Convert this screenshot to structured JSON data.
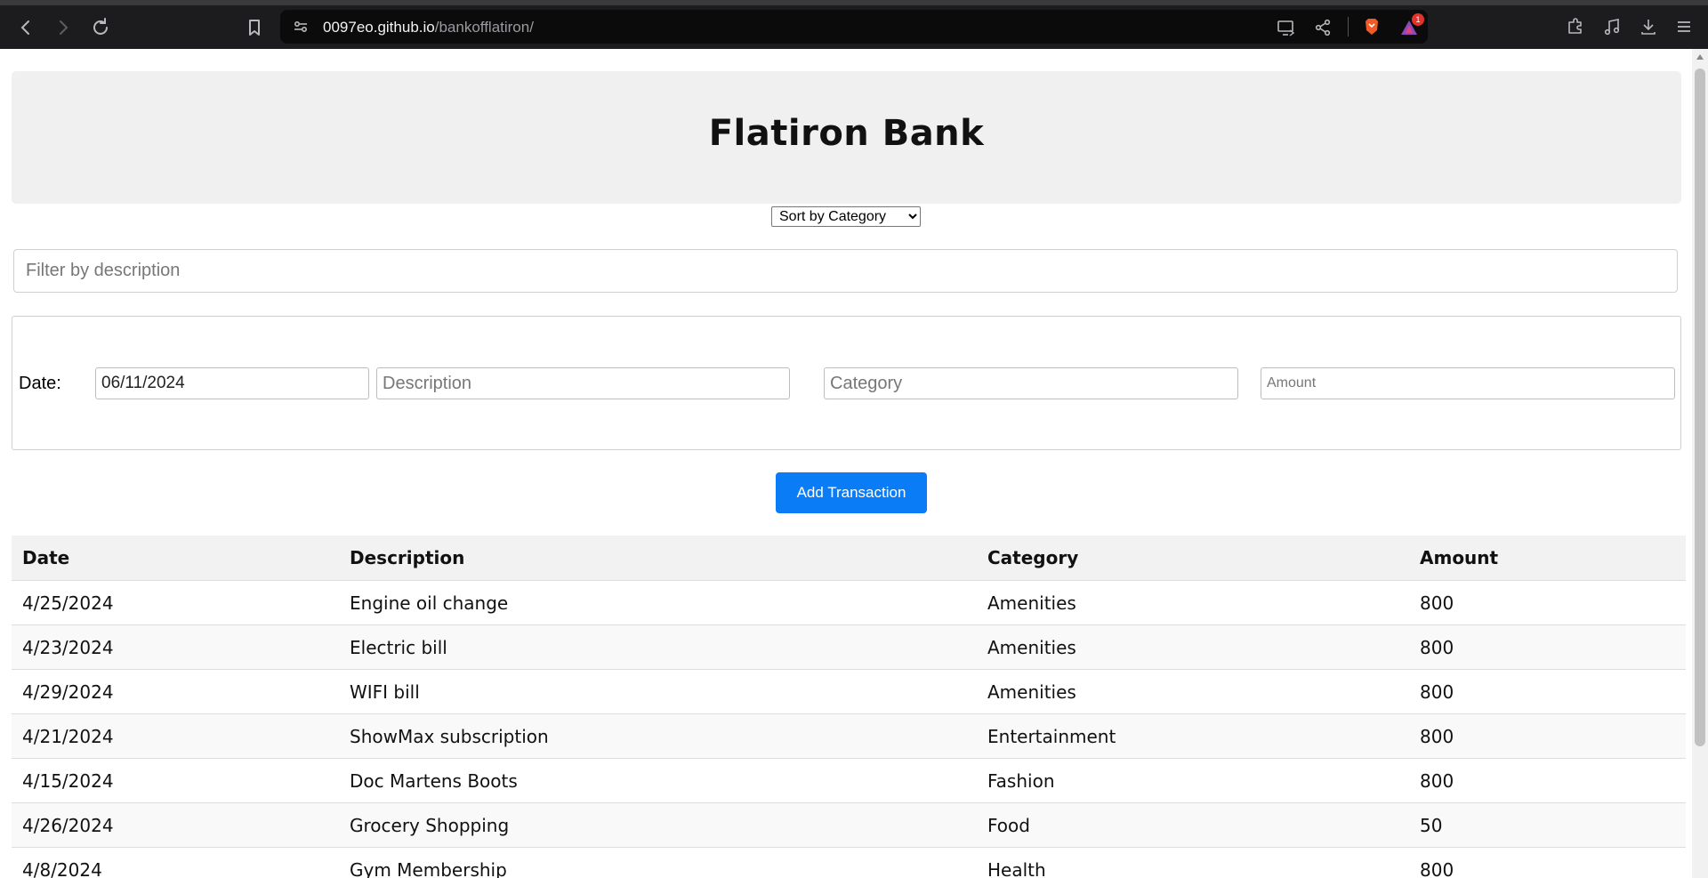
{
  "browser": {
    "url_host": "0097eo.github.io",
    "url_path": "/bankofflatiron/",
    "rewards_badge": "1"
  },
  "header": {
    "title": "Flatiron Bank"
  },
  "sort": {
    "selected": "Sort by Category"
  },
  "filter": {
    "placeholder": "Filter by description",
    "value": ""
  },
  "form": {
    "date_label": "Date:",
    "date_value": "06/11/2024",
    "description_placeholder": "Description",
    "category_placeholder": "Category",
    "amount_placeholder": "Amount"
  },
  "add_button": {
    "label": "Add Transaction",
    "color": "#0a7cf5"
  },
  "table": {
    "headers": [
      "Date",
      "Description",
      "Category",
      "Amount"
    ],
    "rows": [
      {
        "date": "4/25/2024",
        "description": "Engine oil change",
        "category": "Amenities",
        "amount": "800"
      },
      {
        "date": "4/23/2024",
        "description": "Electric bill",
        "category": "Amenities",
        "amount": "800"
      },
      {
        "date": "4/29/2024",
        "description": "WIFI bill",
        "category": "Amenities",
        "amount": "800"
      },
      {
        "date": "4/21/2024",
        "description": "ShowMax subscription",
        "category": "Entertainment",
        "amount": "800"
      },
      {
        "date": "4/15/2024",
        "description": "Doc Martens Boots",
        "category": "Fashion",
        "amount": "800"
      },
      {
        "date": "4/26/2024",
        "description": "Grocery Shopping",
        "category": "Food",
        "amount": "50"
      },
      {
        "date": "4/8/2024",
        "description": "Gym Membership",
        "category": "Health",
        "amount": "800"
      }
    ]
  }
}
